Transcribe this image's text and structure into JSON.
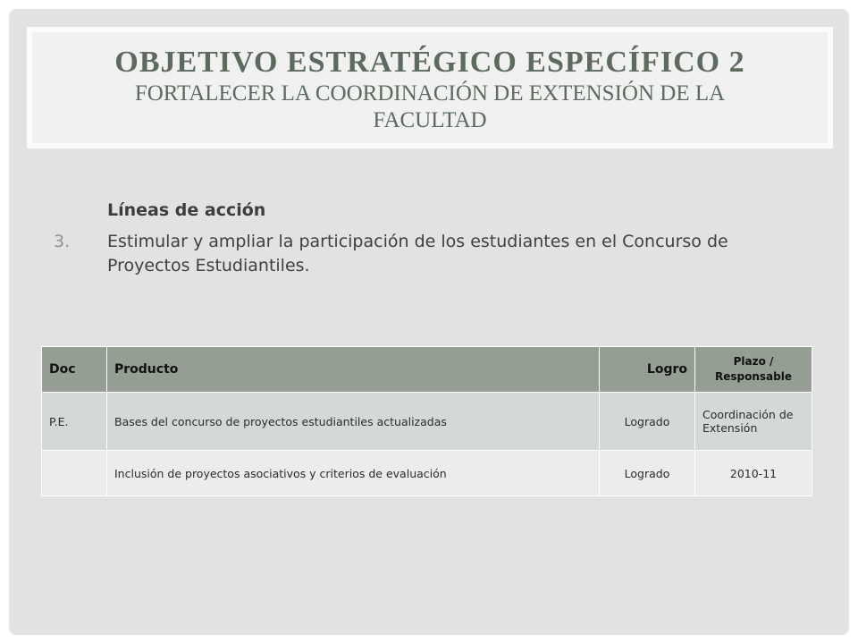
{
  "slide": {
    "title": "OBJETIVO ESTRATÉGICO ESPECÍFICO 2",
    "subtitle": "FORTALECER LA COORDINACIÓN DE EXTENSIÓN DE LA FACULTAD"
  },
  "content": {
    "heading": "Líneas de acción",
    "item_number": "3.",
    "item_text": "Estimular y ampliar la participación de los estudiantes en el Concurso de Proyectos Estudiantiles."
  },
  "table": {
    "headers": {
      "doc": "Doc",
      "producto": "Producto",
      "logro": "Logro",
      "plazo": "Plazo / Responsable"
    },
    "rows": [
      {
        "doc": "P.E.",
        "producto": "Bases del concurso de proyectos estudiantiles actualizadas",
        "logro": "Logrado",
        "plazo": "Coordinación de Extensión"
      },
      {
        "doc": "",
        "producto": "Inclusión de proyectos asociativos y criterios de evaluación",
        "logro": "Logrado",
        "plazo": "2010-11"
      }
    ]
  },
  "colors": {
    "title_text": "#5c6b5e",
    "header_bg": "#949e93",
    "row1_bg": "#d5d9d5",
    "row2_bg": "#ececec",
    "slide_bg": "#e2e2e2"
  }
}
